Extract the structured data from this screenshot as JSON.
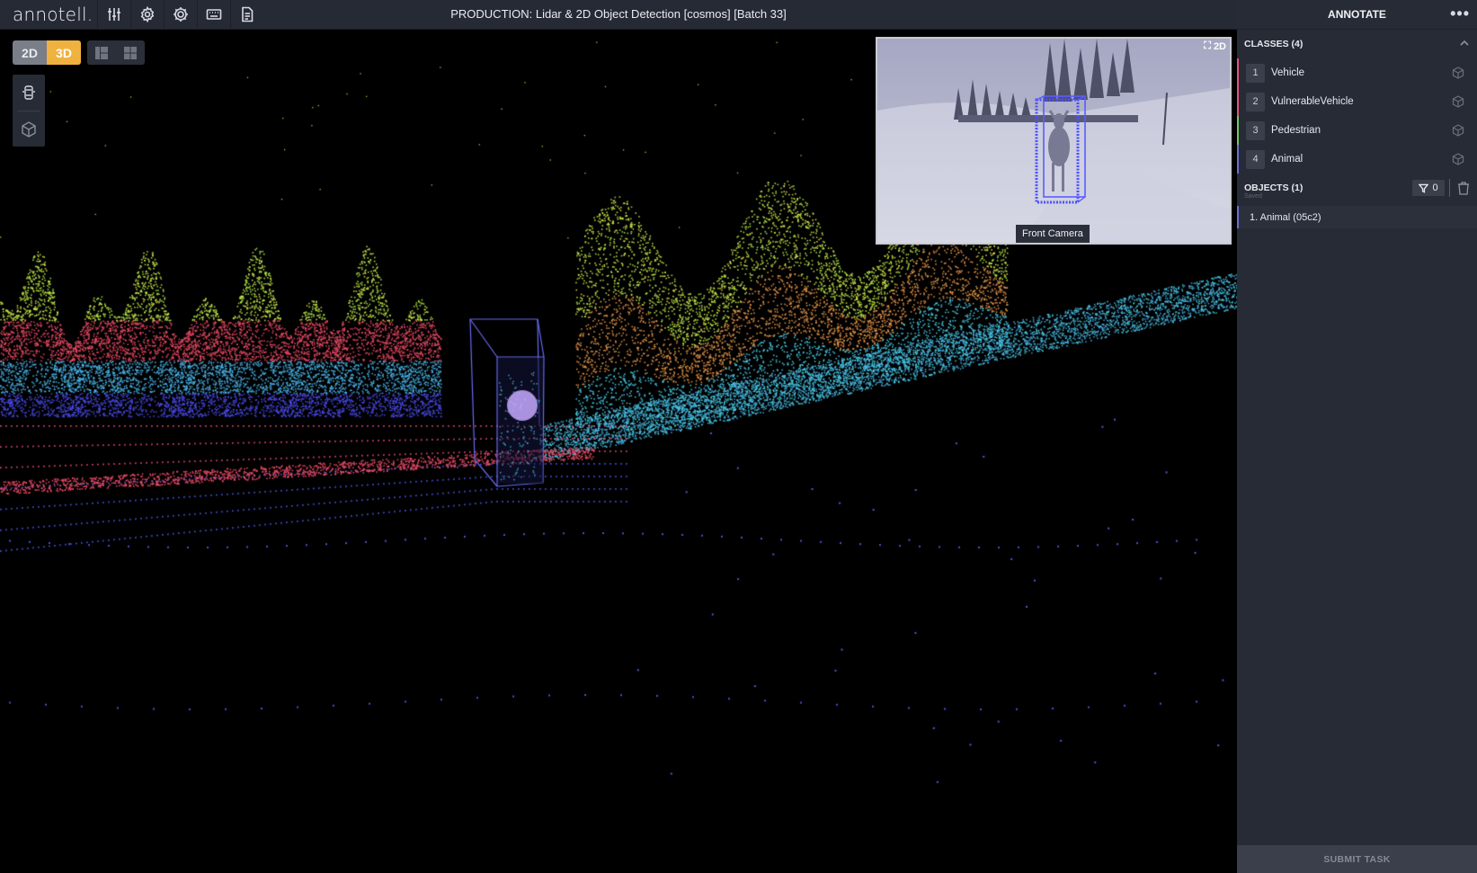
{
  "app": {
    "logo": "annotell.",
    "title": "PRODUCTION: Lidar & 2D Object Detection [cosmos] [Batch 33]"
  },
  "toolbar": {
    "icons": [
      "sliders-icon",
      "settings-icon",
      "settings-gear-icon",
      "keyboard-icon",
      "document-icon"
    ]
  },
  "viewport": {
    "mode_2d": "2D",
    "mode_3d": "3D",
    "active_mode": "3D",
    "camera": {
      "label": "Front Camera",
      "toggle_label": "2D"
    }
  },
  "panel": {
    "header": "ANNOTATE",
    "classes_title": "CLASSES (4)",
    "classes": [
      {
        "num": "1",
        "label": "Vehicle",
        "color": "#e0567a"
      },
      {
        "num": "2",
        "label": "VulnerableVehicle",
        "color": "#e0567a"
      },
      {
        "num": "3",
        "label": "Pedestrian",
        "color": "#7ac36a"
      },
      {
        "num": "4",
        "label": "Animal",
        "color": "#6b6fd6"
      }
    ],
    "objects_title": "OBJECTS (1)",
    "objects_saved": "Saved",
    "filter_count": "0",
    "objects": [
      {
        "label": "1. Animal (05c2)"
      }
    ],
    "submit_label": "SUBMIT TASK"
  },
  "colors": {
    "accent_3d": "#f0b23e",
    "box": "#6b6fff",
    "panel_bg": "#272b36"
  }
}
